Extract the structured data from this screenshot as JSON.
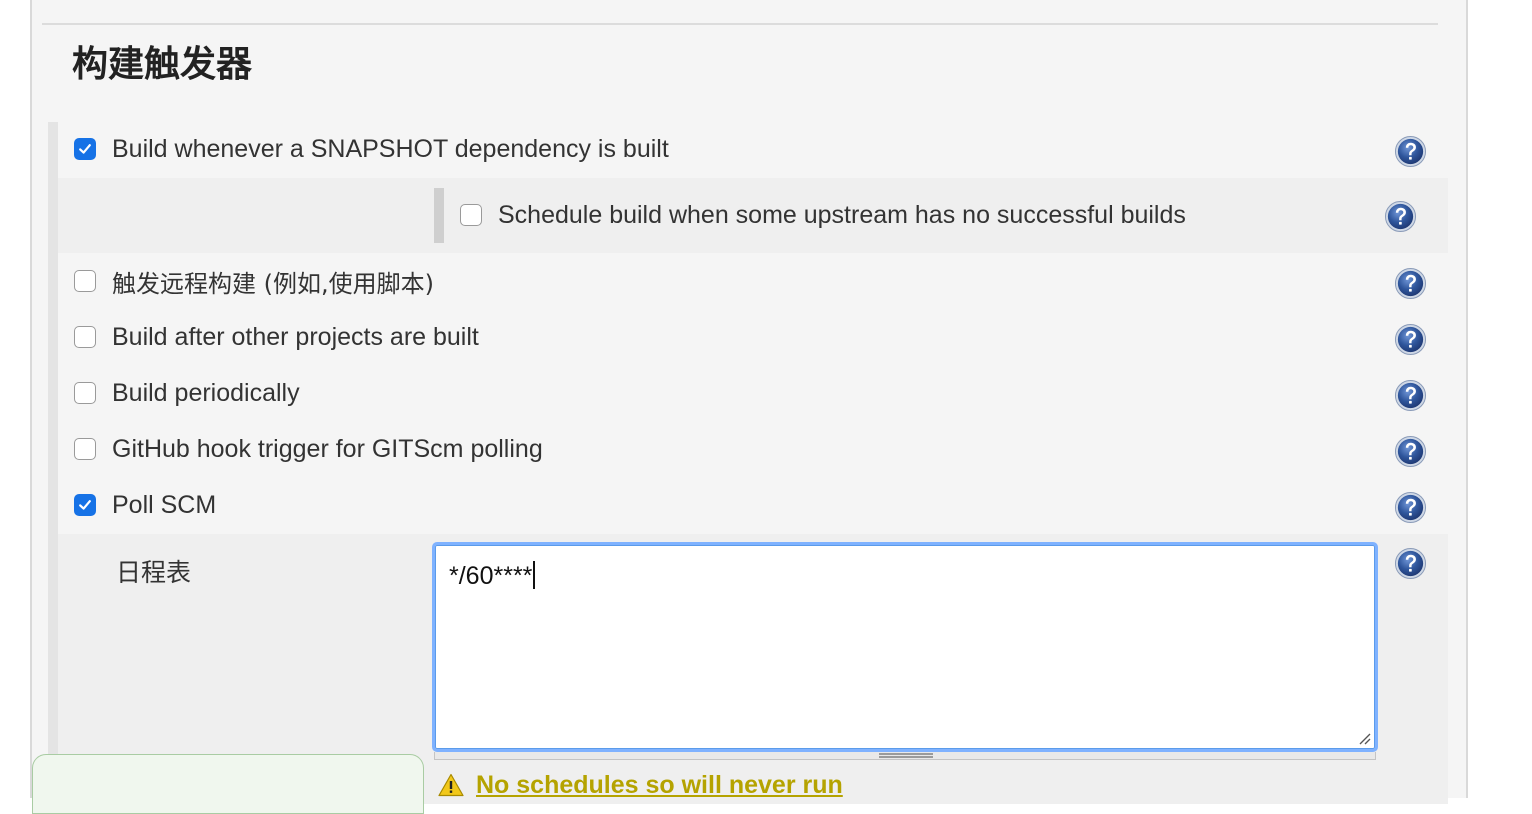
{
  "section": {
    "title": "构建触发器"
  },
  "triggers": [
    {
      "label": "Build whenever a SNAPSHOT dependency is built",
      "checked": true
    },
    {
      "label": "Schedule build when some upstream has no successful builds",
      "checked": false
    },
    {
      "label": "触发远程构建 (例如,使用脚本)",
      "checked": false
    },
    {
      "label": "Build after other projects are built",
      "checked": false
    },
    {
      "label": "Build periodically",
      "checked": false
    },
    {
      "label": "GitHub hook trigger for GITScm polling",
      "checked": false
    },
    {
      "label": "Poll SCM",
      "checked": true
    }
  ],
  "poll_scm": {
    "schedule_label": "日程表",
    "schedule_value": "*/60****",
    "warning": "No schedules so will never run"
  },
  "colors": {
    "checkbox_checked": "#1672e6",
    "help_icon": "#2b4f91",
    "warning_text": "#b5a300",
    "focus_ring": "#7fb2ff"
  },
  "icons": {
    "help": "help-question-icon",
    "check": "check-icon",
    "warning": "warning-triangle-icon",
    "resize": "resize-grip-icon"
  }
}
